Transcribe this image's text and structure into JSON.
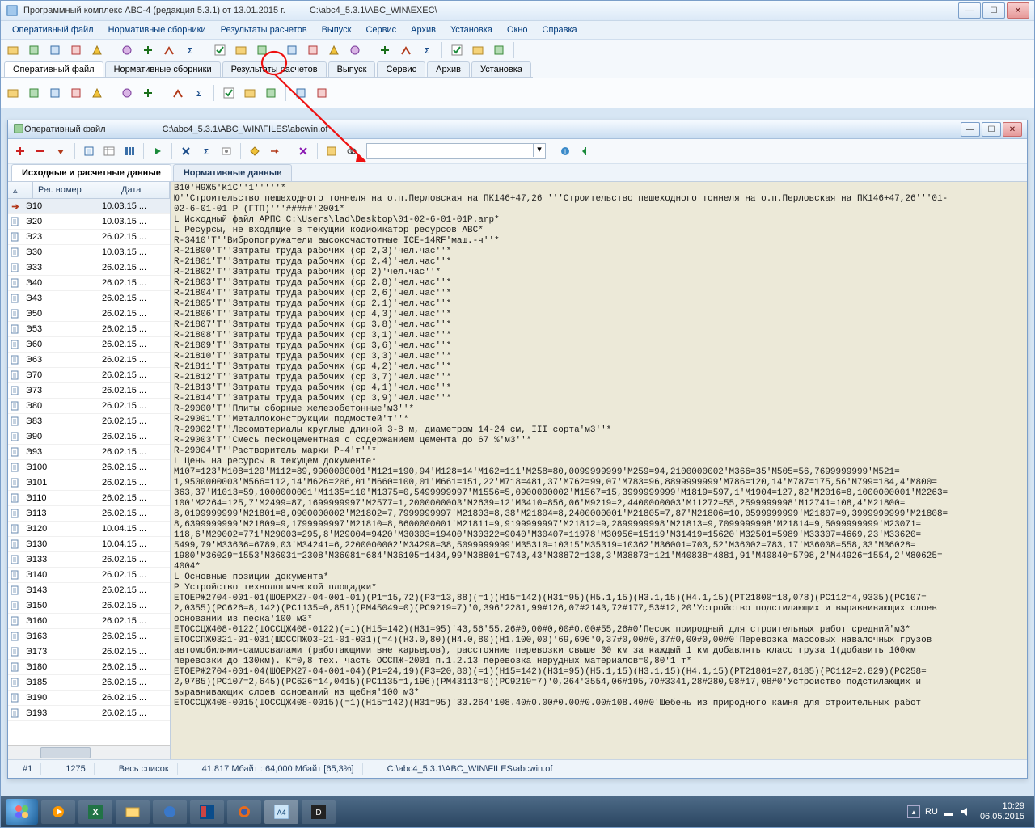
{
  "outer": {
    "title": "Программный комплекс АВС-4 (редакция 5.3.1) от 13.01.2015 г.",
    "path": "C:\\abc4_5.3.1\\ABC_WIN\\EXEC\\"
  },
  "menu": [
    "Оперативный файл",
    "Нормативные сборники",
    "Результаты расчетов",
    "Выпуск",
    "Сервис",
    "Архив",
    "Установка",
    "Окно",
    "Справка"
  ],
  "tool_tabs": [
    "Оперативный файл",
    "Нормативные сборники",
    "Результаты расчетов",
    "Выпуск",
    "Сервис",
    "Архив",
    "Установка"
  ],
  "child": {
    "title": "Оперативный файл",
    "path": "C:\\abc4_5.3.1\\ABC_WIN\\FILES\\abcwin.of"
  },
  "data_tabs": [
    "Исходные и расчетные данные",
    "Нормативные данные"
  ],
  "grid_header": {
    "reg": "Рег. номер",
    "date": "Дата"
  },
  "rows": [
    {
      "reg": "Э10",
      "date": "10.03.15 ...",
      "sel": true,
      "arrow": true
    },
    {
      "reg": "Э20",
      "date": "10.03.15 ..."
    },
    {
      "reg": "Э23",
      "date": "26.02.15 ..."
    },
    {
      "reg": "Э30",
      "date": "10.03.15 ..."
    },
    {
      "reg": "Э33",
      "date": "26.02.15 ..."
    },
    {
      "reg": "Э40",
      "date": "26.02.15 ..."
    },
    {
      "reg": "Э43",
      "date": "26.02.15 ..."
    },
    {
      "reg": "Э50",
      "date": "26.02.15 ..."
    },
    {
      "reg": "Э53",
      "date": "26.02.15 ..."
    },
    {
      "reg": "Э60",
      "date": "26.02.15 ..."
    },
    {
      "reg": "Э63",
      "date": "26.02.15 ..."
    },
    {
      "reg": "Э70",
      "date": "26.02.15 ..."
    },
    {
      "reg": "Э73",
      "date": "26.02.15 ..."
    },
    {
      "reg": "Э80",
      "date": "26.02.15 ..."
    },
    {
      "reg": "Э83",
      "date": "26.02.15 ..."
    },
    {
      "reg": "Э90",
      "date": "26.02.15 ..."
    },
    {
      "reg": "Э93",
      "date": "26.02.15 ..."
    },
    {
      "reg": "Э100",
      "date": "26.02.15 ..."
    },
    {
      "reg": "Э101",
      "date": "26.02.15 ..."
    },
    {
      "reg": "Э110",
      "date": "26.02.15 ..."
    },
    {
      "reg": "Э113",
      "date": "26.02.15 ..."
    },
    {
      "reg": "Э120",
      "date": "10.04.15 ..."
    },
    {
      "reg": "Э130",
      "date": "10.04.15 ..."
    },
    {
      "reg": "Э133",
      "date": "26.02.15 ..."
    },
    {
      "reg": "Э140",
      "date": "26.02.15 ..."
    },
    {
      "reg": "Э143",
      "date": "26.02.15 ..."
    },
    {
      "reg": "Э150",
      "date": "26.02.15 ..."
    },
    {
      "reg": "Э160",
      "date": "26.02.15 ..."
    },
    {
      "reg": "Э163",
      "date": "26.02.15 ..."
    },
    {
      "reg": "Э173",
      "date": "26.02.15 ..."
    },
    {
      "reg": "Э180",
      "date": "26.02.15 ..."
    },
    {
      "reg": "Э185",
      "date": "26.02.15 ..."
    },
    {
      "reg": "Э190",
      "date": "26.02.15 ..."
    },
    {
      "reg": "Э193",
      "date": "26.02.15 ..."
    }
  ],
  "text_lines": [
    "В10'Н9Ж5'К1С''1'''''*",
    "Ю''Строительство пешеходного тоннеля на о.п.Перловская на ПК146+47,26 '''Строительство пешеходного тоннеля на о.п.Перловская на ПК146+47,26'''01-",
    "02-6-01-01 Р (ГТП)'''#####'2001*",
    "L Исходный файл АРПС C:\\Users\\lad\\Desktop\\01-02-6-01-01Р.arp*",
    "L Ресурсы, не входящие в текущий кодификатор ресурсов АВС*",
    "R-3410'Т''Вибропогружатели высокочастотные ICE-14RF'маш.-ч''*",
    "R-21800'Т''Затраты труда рабочих (ср 2,3)'чел.час''*",
    "R-21801'Т''Затраты труда рабочих (ср 2,4)'чел.час''*",
    "R-21802'Т''Затраты труда рабочих (ср 2)'чел.час''*",
    "R-21803'Т''Затраты труда рабочих (ср 2,8)'чел.час''*",
    "R-21804'Т''Затраты труда рабочих (ср 2,6)'чел.час''*",
    "R-21805'Т''Затраты труда рабочих (ср 2,1)'чел.час''*",
    "R-21806'Т''Затраты труда рабочих (ср 4,3)'чел.час''*",
    "R-21807'Т''Затраты труда рабочих (ср 3,8)'чел.час''*",
    "R-21808'Т''Затраты труда рабочих (ср 3,1)'чел.час''*",
    "R-21809'Т''Затраты труда рабочих (ср 3,6)'чел.час''*",
    "R-21810'Т''Затраты труда рабочих (ср 3,3)'чел.час''*",
    "R-21811'Т''Затраты труда рабочих (ср 4,2)'чел.час''*",
    "R-21812'Т''Затраты труда рабочих (ср 3,7)'чел.час''*",
    "R-21813'Т''Затраты труда рабочих (ср 4,1)'чел.час''*",
    "R-21814'Т''Затраты труда рабочих (ср 3,9)'чел.час''*",
    "R-29000'Т''Плиты сборные железобетонные'м3''*",
    "R-29001'Т''Металлоконструкции подмостей'т''*",
    "R-29002'Т''Лесоматериалы круглые длиной 3-8 м, диаметром 14-24 см, III сорта'м3''*",
    "R-29003'Т''Смесь пескоцементная с содержанием цемента до 67 %'м3''*",
    "R-29004'Т''Растворитель марки Р-4'т''*",
    "L Цены на ресурсы в текущем документе*",
    "М107=123'M108=120'M112=89,9900000001'M121=190,94'M128=14'M162=111'M258=80,0099999999'M259=94,2100000002'M366=35'M505=56,7699999999'М521=",
    "1,9500000003'M566=112,14'M626=206,01'M660=100,01'M661=151,22'M718=481,37'M762=99,07'M783=96,8899999999'M786=120,14'M787=175,56'M799=184,4'M800=",
    "363,37'M1013=59,1000000001'M1135=110'M1375=0,5499999997'M1556=5,0900000002'M1567=15,3999999999'M1819=597,1'M1904=127,82'M2016=8,1000000001'M2263=",
    "100'M2264=125,7'M2499=87,1699999997'M2577=1,2000000003'M2639=12'M3410=856,06'M9219=2,4400000003'M11272=55,2599999998'M12741=108,4'M21800=",
    "8,0199999999'M21801=8,0900000002'M21802=7,7999999997'M21803=8,38'M21804=8,2400000001'M21805=7,87'M21806=10,0599999999'M21807=9,3999999999'M21808=",
    "8,6399999999'M21809=9,1799999997'M21810=8,8600000001'M21811=9,9199999997'M21812=9,2899999998'M21813=9,7099999998'M21814=9,5099999999'M23071=",
    "118,6'M29002=771'M29003=295,8'M29004=9420'M30303=19400'M30322=9040'M30407=11978'M30956=15119'M31419=15620'M32501=5989'M33307=4669,23'M33620=",
    "5499,79'M33636=6789,03'M34241=6,2200000002'M34298=38,5099999999'M35310=10315'М35319=10362'M36001=703,52'M36002=783,17'M36008=558,33'M36028=",
    "1980'M36029=1553'M36031=2308'M36081=684'M36105=1434,99'M38801=9743,43'M38872=138,3'M38873=121'M40838=4881,91'M40840=5798,2'M44926=1554,2'M80625=",
    "4004*",
    "L Основные позиции документа*",
    "Р Устройство технологической площадки*",
    "ЕТОЕРЖ2704-001-01(ШОЕРЖ27-04-001-01)(Р1=15,72)(Р3=13,88)(=1)(Н15=142)(Н31=95)(Н5.1,15)(Н3.1,15)(Н4.1,15)(РТ21800=18,078)(РС112=4,9335)(РС107=",
    "2,0355)(РС626=8,142)(РС1135=0,851)(РМ45049=0)(РС9219=7)'0,396'2281,99#126,07#2143,72#177,53#12,20'Устройство подстилающих и выравнивающих слоев",
    "оснований из песка'100 м3*",
    "ЕТОССЦЖ408-0122(ШОССЦЖ408-0122)(=1)(Н15=142)(Н31=95)'43,56'55,26#0,00#0,00#0,00#55,26#0'Песок природный для строительных работ средний'м3*",
    "ЕТОССПЖ0321-01-031(ШОССПЖ03-21-01-031)(=4)(Н3.0,80)(Н4.0,80)(Н1.100,00)'69,696'0,37#0,00#0,37#0,00#0,00#0'Перевозка массовых навалочных грузов",
    "автомобилями-самосвалами (работающими вне карьеров), расстояние перевозки свыше 30 км за каждый 1 км добавлять класс груза 1(добавить 100км",
    "перевозки до 130км). К=0,8 тех. часть ОССПЖ-2001 п.1.2.13 перевозка нерудных материалов=0,80'1 т*",
    "ЕТОЕРЖ2704-001-04(ШОЕРЖ27-04-001-04)(Р1=24,19)(Р3=20,80)(=1)(Н15=142)(Н31=95)(Н5.1,15)(Н3.1,15)(Н4.1,15)(РТ21801=27,8185)(РС112=2,829)(РС258=",
    "2,9785)(РС107=2,645)(РС626=14,0415)(РС1135=1,196)(РМ43113=0)(РС9219=7)'0,264'3554,06#195,70#3341,28#280,98#17,08#0'Устройство подстилающих и",
    "выравнивающих слоев оснований из щебня'100 м3*",
    "ЕТОССЦЖ408-0015(ШОССЦЖ408-0015)(=1)(Н15=142)(Н31=95)'33.264'108.40#0.00#0.00#0.00#108.40#0'Шебень из природного камня для строительных работ"
  ],
  "status": {
    "c1": "#1",
    "c2": "1275",
    "c3": "Весь список",
    "c4": "41,817 Мбайт : 64,000 Мбайт  [65,3%]",
    "c5": "C:\\abc4_5.3.1\\ABC_WIN\\FILES\\abcwin.of"
  },
  "tray": {
    "lang": "RU",
    "time": "10:29",
    "date": "06.05.2015"
  }
}
